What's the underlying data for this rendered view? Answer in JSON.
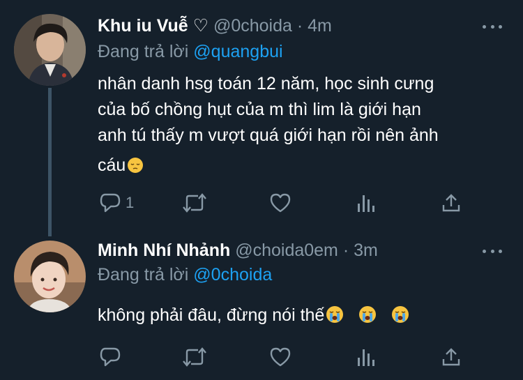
{
  "tweets": [
    {
      "name": "Khu iu Vuễ ♡",
      "handle": "@0choida",
      "separator": "·",
      "time": "4m",
      "reply_prefix": "Đang trả lời",
      "reply_to": "@quangbui",
      "text_lines": [
        "nhân danh hsg toán 12 năm, học sinh cưng",
        "của bố chồng hụt của m thì lim là giới hạn",
        "anh tú thấy m vượt quá giới hạn rồi nên ảnh",
        "cáu"
      ],
      "emojis": [
        "pensive-face"
      ],
      "reply_count": "1",
      "avatar": "avatar-photo"
    },
    {
      "name": "Minh Nhí Nhảnh",
      "handle": "@choida0em",
      "separator": "·",
      "time": "3m",
      "reply_prefix": "Đang trả lời",
      "reply_to": "@0choida",
      "text_lines": [
        "không phải đâu, đừng nói thế"
      ],
      "emojis": [
        "crying-face",
        "crying-face",
        "crying-face"
      ],
      "reply_count": "",
      "avatar": "avatar-photo"
    }
  ],
  "colors": {
    "background": "#15202b",
    "text": "#ffffff",
    "secondary": "#8899a6",
    "accent": "#1da1f2",
    "thread_line": "#3d5466"
  },
  "icons": [
    "more-icon",
    "reply-icon",
    "retweet-icon",
    "like-icon",
    "analytics-icon",
    "share-icon"
  ]
}
